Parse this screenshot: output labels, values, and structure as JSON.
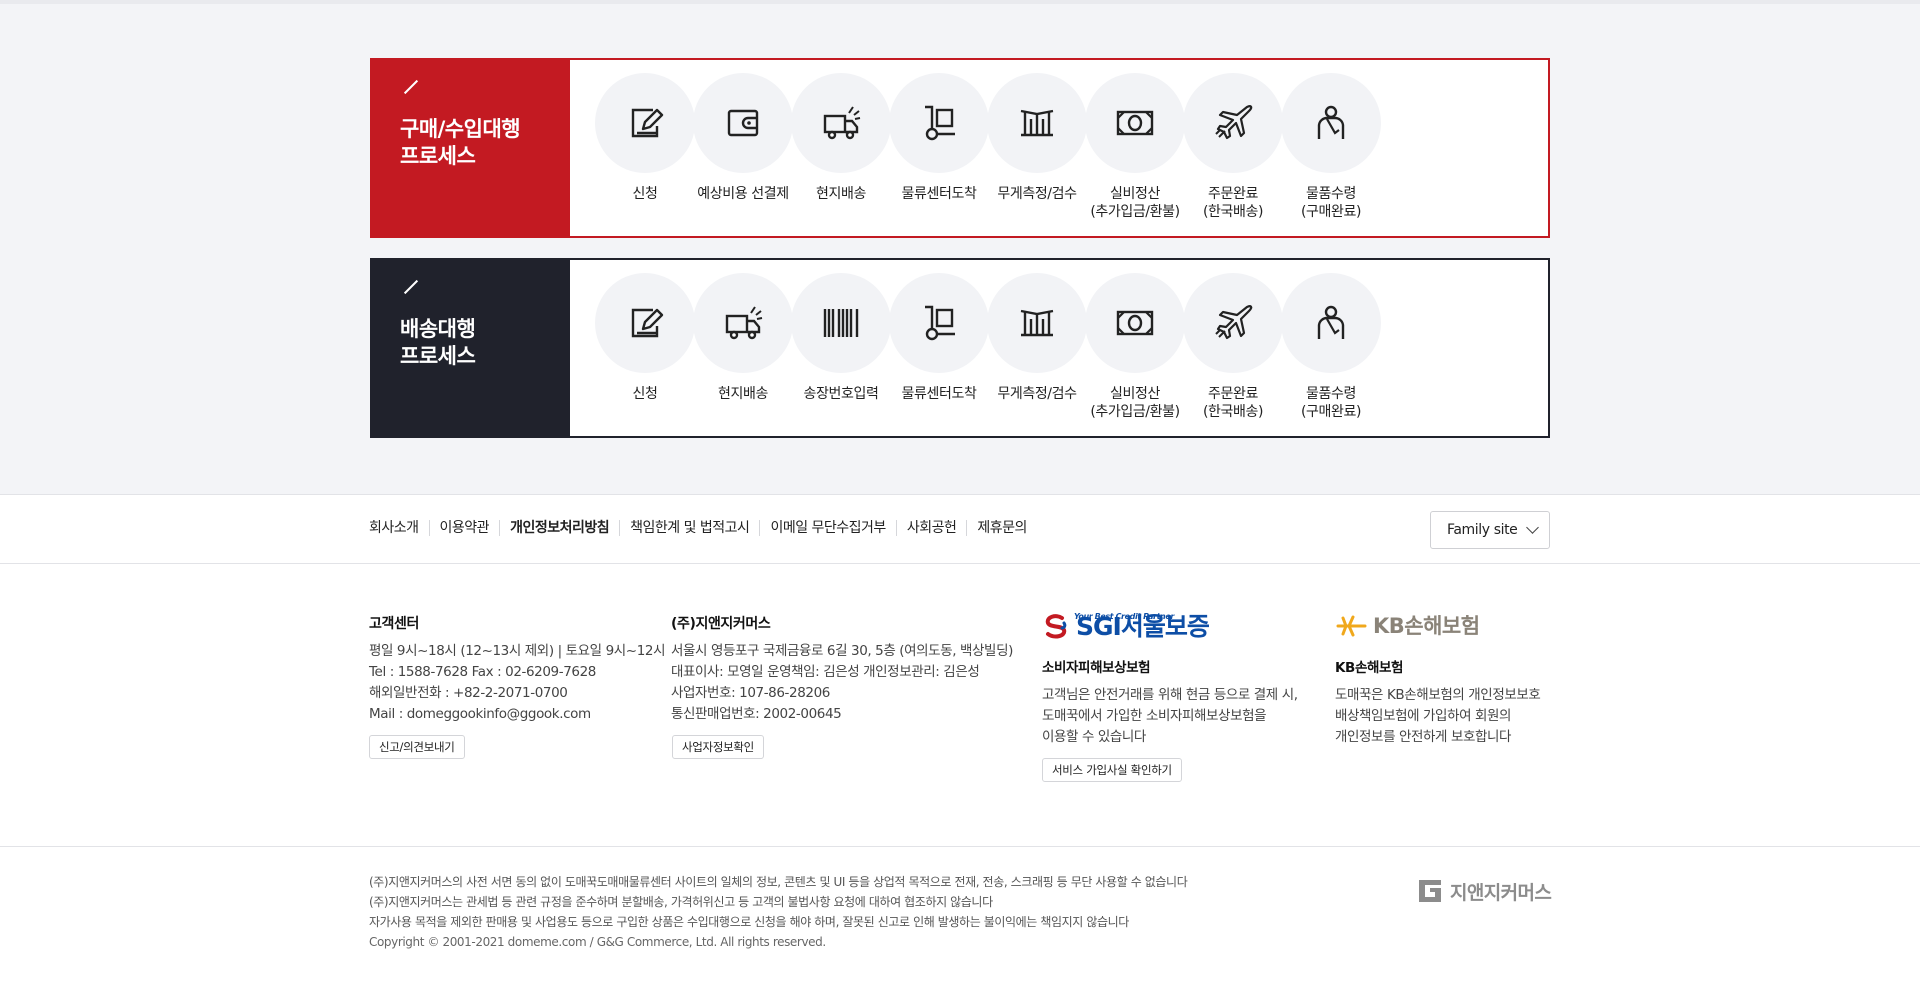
{
  "process_purchase": {
    "title": "구매/수입대행\n프로세스",
    "steps": [
      {
        "label": "신청",
        "icon": "edit-icon"
      },
      {
        "label": "예상비용 선결제",
        "icon": "wallet-icon"
      },
      {
        "label": "현지배송",
        "icon": "truck-icon"
      },
      {
        "label": "물류센터도착",
        "icon": "hand-truck-icon"
      },
      {
        "label": "무게측정/검수",
        "icon": "scale-icon"
      },
      {
        "label": "실비정산\n(추가입금/환불)",
        "icon": "money-icon"
      },
      {
        "label": "주문완료\n(한국배송)",
        "icon": "airplane-icon"
      },
      {
        "label": "물품수령\n(구매완료)",
        "icon": "person-icon"
      }
    ]
  },
  "process_shipping": {
    "title": "배송대행\n프로세스",
    "steps": [
      {
        "label": "신청",
        "icon": "edit-icon"
      },
      {
        "label": "현지배송",
        "icon": "truck-icon"
      },
      {
        "label": "송장번호입력",
        "icon": "barcode-icon"
      },
      {
        "label": "물류센터도착",
        "icon": "hand-truck-icon"
      },
      {
        "label": "무게측정/검수",
        "icon": "scale-icon"
      },
      {
        "label": "실비정산\n(추가입금/환불)",
        "icon": "money-icon"
      },
      {
        "label": "주문완료\n(한국배송)",
        "icon": "airplane-icon"
      },
      {
        "label": "물품수령\n(구매완료)",
        "icon": "person-icon"
      }
    ]
  },
  "footer_nav": {
    "links": [
      "회사소개",
      "이용약관",
      "개인정보처리방침",
      "책임한계 및 법적고시",
      "이메일 무단수집거부",
      "사회공헌",
      "제휴문의"
    ],
    "familysite": "Family site"
  },
  "customer_center": {
    "title": "고객센터",
    "lines": [
      "평일 9시~18시 (12~13시 제외) | 토요일 9시~12시",
      "Tel : 1588-7628 Fax : 02-6209-7628",
      "해외일반전화 : +82-2-2071-0700",
      "Mail : domeggookinfo@ggook.com"
    ],
    "button": "신고/의견보내기"
  },
  "company": {
    "title": "(주)지앤지커머스",
    "lines": [
      "서울시 영등포구 국제금융로 6길 30, 5층 (여의도동, 백상빌딩)",
      "대표이사: 모영일 운영책임: 김은성 개인정보관리: 김은성",
      "사업자번호: 107-86-28206",
      "통신판매업번호: 2002-00645"
    ],
    "button": "사업자정보확인"
  },
  "sgi": {
    "logo_small": "Your Best Credit Partner",
    "logo_main": "SGI서울보증",
    "title": "소비자피해보상보험",
    "lines": [
      "고객님은 안전거래를 위해 현금 등으로 결제 시,",
      "도매꾹에서 가입한 소비자피해보상보험을",
      "이용할 수 있습니다"
    ],
    "button": "서비스 가입사실 확인하기"
  },
  "kb": {
    "logo_text": "KB손해보험",
    "title": "KB손해보험",
    "lines": [
      "도매꾹은 KB손해보험의 개인정보보호",
      "배상책임보험에 가입하여 회원의",
      "개인정보를 안전하게 보호합니다"
    ]
  },
  "legal": {
    "lines": [
      "(주)지앤지커머스의 사전 서면 동의 없이 도매꾹도매매물류센터 사이트의 일체의 정보, 콘텐츠 및 UI 등을 상업적 목적으로 전재, 전송, 스크래핑 등 무단 사용할 수 없습니다",
      "(주)지앤지커머스는 관세법 등 관련 규정을 준수하며 분할배송, 가격허위신고 등 고객의 불법사항 요청에 대하여 협조하지 않습니다",
      "자가사용 목적을 제외한 판매용 및 사업용도 등으로 구입한 상품은 수입대행으로 신청을 해야 하며, 잘못된 신고로 인해 발생하는 불이익에는 책임지지 않습니다"
    ],
    "copyright": "Copyright © 2001-2021 domeme.com / G&G Commerce, Ltd. All rights reserved.",
    "brand_logo": "지앤지커머스"
  },
  "colors": {
    "accent_red": "#c31a22",
    "dark_navy": "#20222c",
    "sgi_blue": "#0d4ea6",
    "kb_gold": "#f0a81c"
  }
}
